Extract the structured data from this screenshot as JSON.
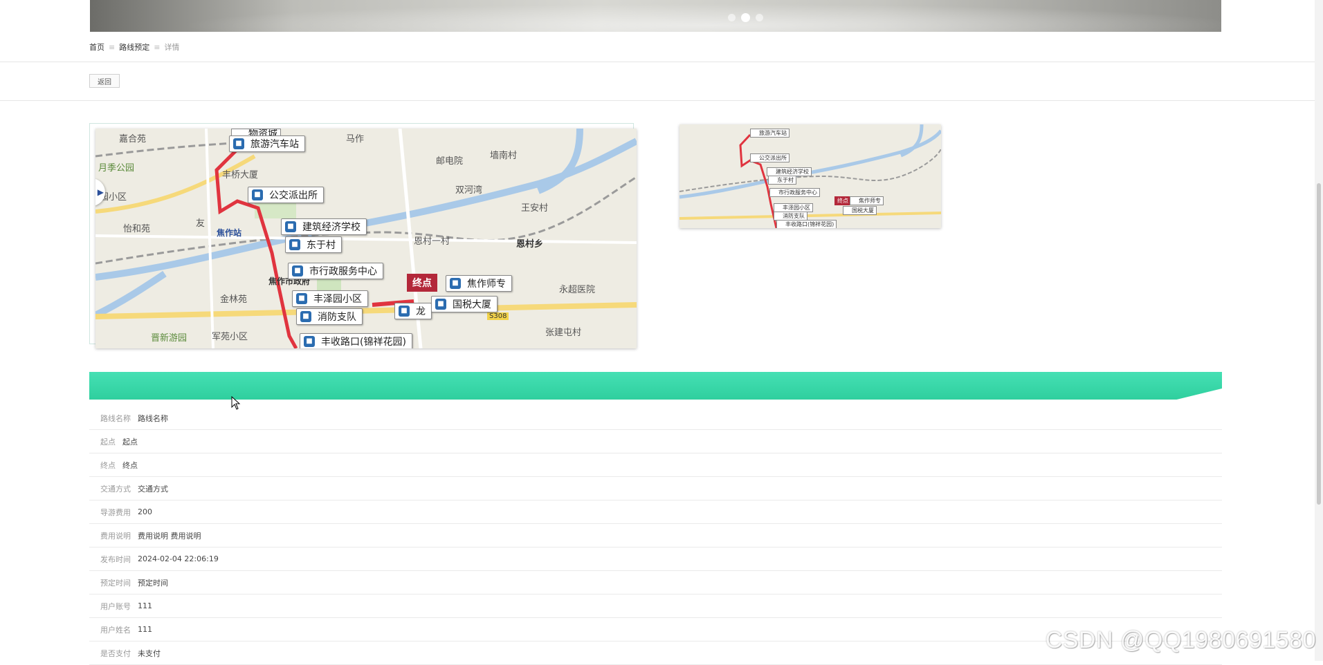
{
  "breadcrumb": {
    "home": "首页",
    "route": "路线预定",
    "current": "详情",
    "separator": "≡"
  },
  "back_button": "返回",
  "map": {
    "labels": {
      "stations": [
        "旅游汽车站",
        "公交派出所",
        "建筑经济学校",
        "东于村",
        "市行政服务中心",
        "丰泽园小区",
        "消防支队",
        "龙",
        "国税大厦",
        "丰收路口(锦祥花园)",
        "焦作师专"
      ],
      "end_marker": "终点",
      "places": [
        "嘉合苑",
        "马作",
        "墙南村",
        "月季公园",
        "邮电院",
        "丰桥大厦",
        "双河湾",
        "园小区",
        "王安村",
        "怡和苑",
        "友",
        "焦作站",
        "恩村一村",
        "恩村乡",
        "焦作市政府",
        "金林苑",
        "永超医院",
        "晋新游园",
        "军苑小区",
        "张建屯村",
        "S308",
        "物资城"
      ]
    }
  },
  "details": [
    {
      "label": "路线名称",
      "value": "路线名称"
    },
    {
      "label": "起点",
      "value": "起点"
    },
    {
      "label": "终点",
      "value": "终点"
    },
    {
      "label": "交通方式",
      "value": "交通方式"
    },
    {
      "label": "导游费用",
      "value": "200"
    },
    {
      "label": "费用说明",
      "value": "费用说明 费用说明"
    },
    {
      "label": "发布时间",
      "value": "2024-02-04 22:06:19"
    },
    {
      "label": "预定时间",
      "value": "预定时间"
    },
    {
      "label": "用户账号",
      "value": "111"
    },
    {
      "label": "用户姓名",
      "value": "111"
    },
    {
      "label": "是否支付",
      "value": "未支付"
    }
  ],
  "watermark": "CSDN @QQ1980691580",
  "colors": {
    "accent_green": "#2fcf9e",
    "route_red": "#e0343f",
    "end_marker": "#b3283a"
  }
}
